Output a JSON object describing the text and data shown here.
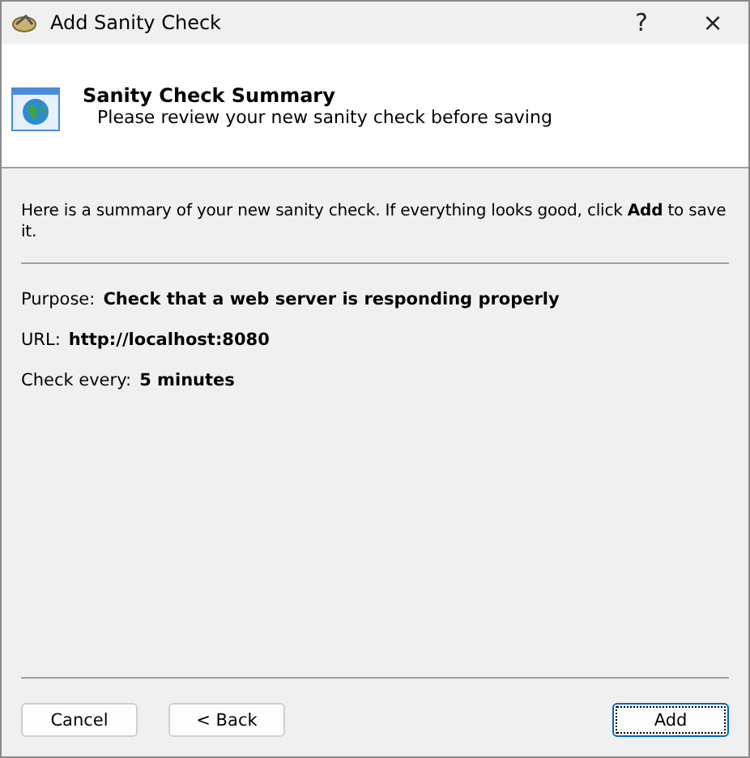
{
  "window": {
    "title": "Add Sanity Check",
    "help": "?",
    "close": "×"
  },
  "header": {
    "title": "Sanity Check Summary",
    "subtitle": "Please review your new sanity check before saving"
  },
  "intro": "Here is a summary of your new sanity check. If everything looks good, click **Add** to save it.",
  "fields": [
    {
      "label": "Purpose:",
      "value": "Check that a web server is responding properly"
    },
    {
      "label": "URL:",
      "value": "http://localhost:8080"
    },
    {
      "label": "Check every:",
      "value": "5 minutes"
    }
  ],
  "left_buttons": [
    {
      "label": "Cancel",
      "focused": false
    },
    {
      "label": "< Back",
      "focused": false
    }
  ],
  "right_buttons": [
    {
      "label": "Add",
      "focused": true
    }
  ]
}
